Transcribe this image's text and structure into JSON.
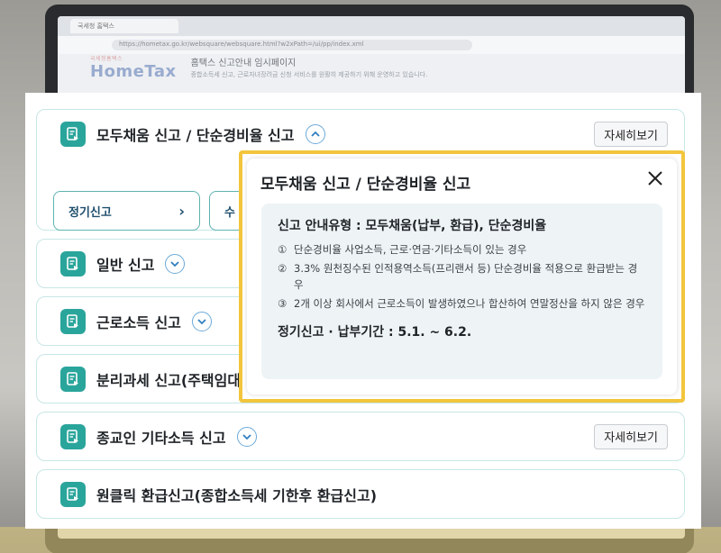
{
  "background": {
    "tab_title": "국세청 홈택스",
    "url": "https://hometax.go.kr/websquare/websquare.html?w2xPath=/ui/pp/index.xml",
    "logo": "HomeTax",
    "logo_sub": "국세청홈택스",
    "header_title": "홈택스 신고안내 임시페이지",
    "header_sub": "종합소득세 신고, 근로자녀장려금 신청 서비스를 원활히 제공하기 위해 운영하고 있습니다."
  },
  "rows": [
    {
      "title": "모두채움 신고 / 단순경비율 신고",
      "chevron": "up",
      "detail_label": "자세히보기"
    },
    {
      "title": "일반 신고",
      "chevron": "down"
    },
    {
      "title": "근로소득 신고",
      "chevron": "down"
    },
    {
      "title": "분리과세 신고(주택임대"
    },
    {
      "title": "종교인 기타소득 신고",
      "chevron": "down",
      "detail_label": "자세히보기"
    },
    {
      "title": "원클릭 환급신고(종합소득세 기한후 환급신고)"
    }
  ],
  "sub_buttons": [
    {
      "label": "정기신고",
      "arrow": "›"
    },
    {
      "label": "수",
      "arrow": ""
    }
  ],
  "popup": {
    "title": "모두채움 신고 / 단순경비율 신고",
    "heading": "신고 안내유형 : 모두채움(납부, 환급), 단순경비율",
    "items": [
      {
        "num": "①",
        "text": "단순경비율 사업소득, 근로·연금·기타소득이 있는 경우"
      },
      {
        "num": "②",
        "text": "3.3% 원천징수된 인적용역소득(프리랜서 등) 단순경비율 적용으로 환급받는 경우"
      },
      {
        "num": "③",
        "text": "2개 이상 회사에서 근로소득이 발생하였으나 합산하여 연말정산을 하지 않은 경우"
      }
    ],
    "footer": "정기신고 · 납부기간 : 5.1. ~ 6.2."
  },
  "colors": {
    "accent": "#2aa59b",
    "highlight": "#f2c53d",
    "row_border": "#c8e6e6"
  }
}
